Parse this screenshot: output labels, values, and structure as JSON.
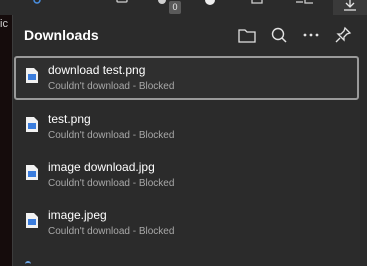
{
  "toolbar": {
    "extensions_badge": "0",
    "icons": [
      "profile-icon",
      "collections-icon",
      "extensions-icon",
      "circle-icon",
      "puzzle-icon",
      "favorites-icon",
      "download-icon"
    ]
  },
  "background_page": {
    "edge_text": "ic"
  },
  "downloads": {
    "title": "Downloads",
    "actions": [
      "open-folder-icon",
      "search-icon",
      "more-options-icon",
      "pin-icon"
    ],
    "items": [
      {
        "name": "download test.png",
        "status": "Couldn't download - Blocked",
        "icon": "image-file-icon"
      },
      {
        "name": "test.png",
        "status": "Couldn't download - Blocked",
        "icon": "image-file-icon"
      },
      {
        "name": "image download.jpg",
        "status": "Couldn't download - Blocked",
        "icon": "image-file-icon"
      },
      {
        "name": "image.jpeg",
        "status": "Couldn't download - Blocked",
        "icon": "image-file-icon"
      }
    ]
  },
  "colors": {
    "panel_bg": "#2b2b2b",
    "selected_border": "#9a9a9a",
    "text_primary": "#ffffff",
    "text_secondary": "#a8a8a8",
    "file_icon_blue": "#3b7ddd"
  }
}
